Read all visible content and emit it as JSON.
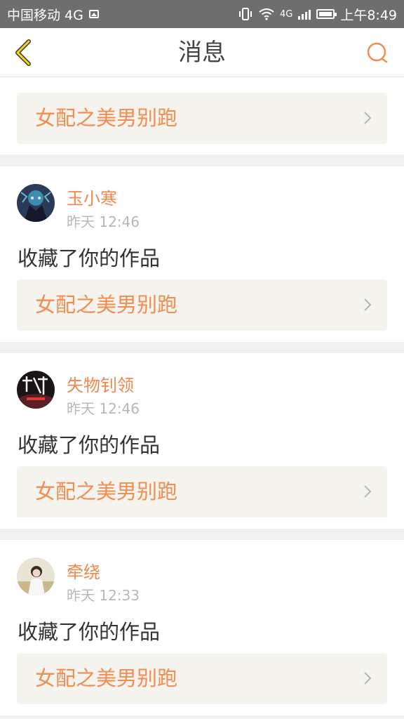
{
  "status_bar": {
    "carrier": "中国移动 4G",
    "network_label": "4G",
    "time": "上午8:49"
  },
  "header": {
    "title": "消息",
    "back_icon": "back-chevron-icon",
    "search_icon": "search-icon"
  },
  "colors": {
    "accent": "#f28d52",
    "card_bg": "#f4f3ee",
    "status_bar_bg": "#6e6e6e"
  },
  "top_card": {
    "title": "女配之美男别跑"
  },
  "messages": [
    {
      "username": "玉小寒",
      "time": "昨天 12:46",
      "action": "收藏了你的作品",
      "work_title": "女配之美男别跑"
    },
    {
      "username": "失物钊领",
      "time": "昨天 12:46",
      "action": "收藏了你的作品",
      "work_title": "女配之美男别跑"
    },
    {
      "username": "牵绕",
      "time": "昨天 12:33",
      "action": "收藏了你的作品",
      "work_title": "女配之美男别跑"
    }
  ]
}
